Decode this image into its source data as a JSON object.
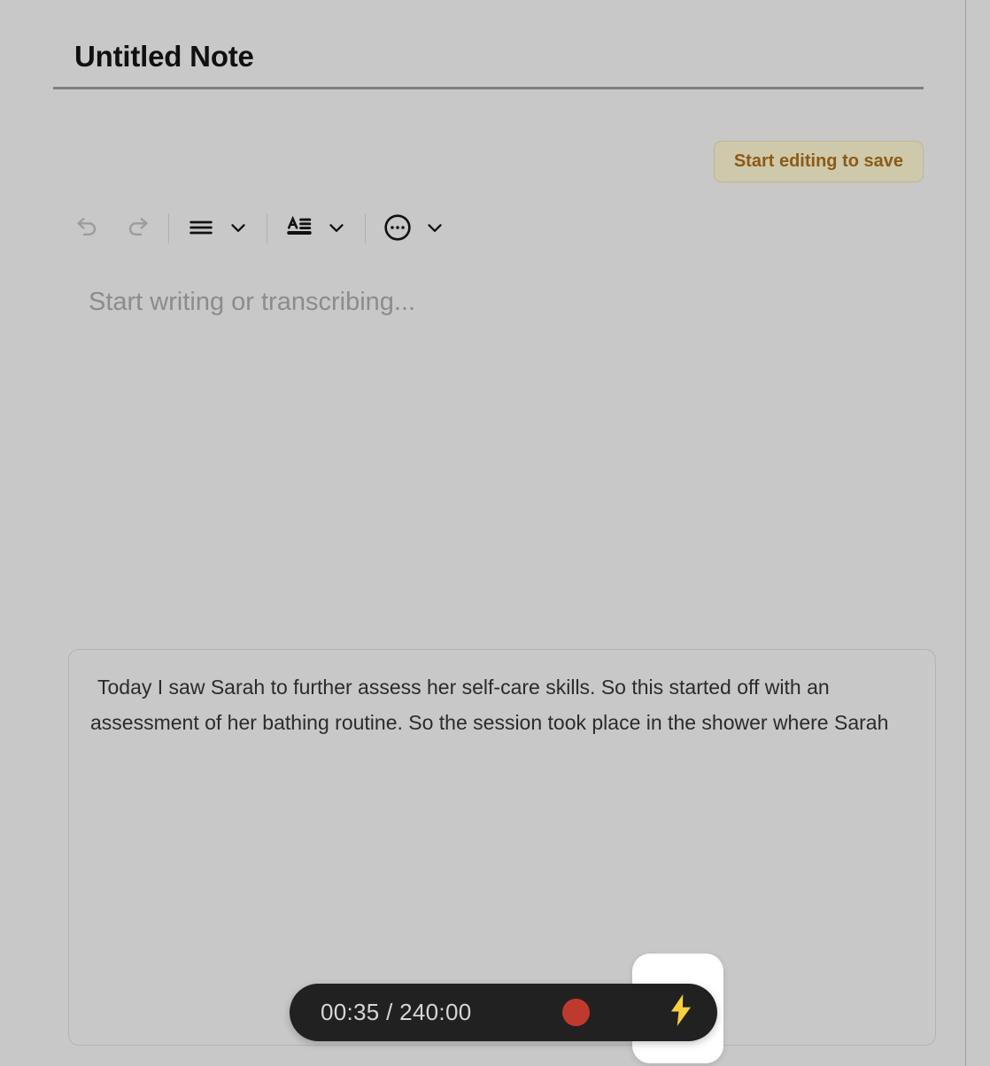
{
  "note": {
    "title": "Untitled Note",
    "save_status_label": "Start editing to save",
    "editor_placeholder": "Start writing or transcribing...",
    "editor_value": ""
  },
  "toolbar": {
    "items": [
      {
        "name": "undo-button",
        "icon": "undo-icon",
        "label": "Undo",
        "state": "disabled"
      },
      {
        "name": "redo-button",
        "icon": "redo-icon",
        "label": "Redo",
        "state": "disabled"
      },
      {
        "name": "align-button",
        "icon": "align-lines-icon",
        "label": "Alignment",
        "state": "enabled"
      },
      {
        "name": "align-dropdown",
        "icon": "chevron-down-icon",
        "label": "Alignment options",
        "state": "enabled"
      },
      {
        "name": "text-style-button",
        "icon": "text-format-a-icon",
        "label": "Text style",
        "state": "enabled"
      },
      {
        "name": "text-style-dropdown",
        "icon": "chevron-down-icon",
        "label": "Text style options",
        "state": "enabled"
      },
      {
        "name": "more-button",
        "icon": "circle-ellipsis-icon",
        "label": "More",
        "state": "enabled"
      },
      {
        "name": "more-dropdown",
        "icon": "chevron-down-icon",
        "label": "More options",
        "state": "enabled"
      }
    ]
  },
  "transcript": {
    "text": "Today I saw Sarah to further assess her self-care skills. So this started off with an assessment of her bathing routine. So the session took place in the shower where Sarah"
  },
  "recorder": {
    "elapsed": "00:35",
    "separator": "/",
    "total": "240:00",
    "timer_display": "00:35 / 240:00",
    "record_button_name": "stop-record-button",
    "boost_icon": "lightning-bolt-icon"
  },
  "colors": {
    "page_background": "#c8c8c8",
    "save_pill_background": "#cfc9ab",
    "save_pill_text": "#8c5a16",
    "recorder_pill_background": "#212121",
    "record_dot": "#c0392f",
    "bolt_yellow": "#f8cf3d",
    "boost_card": "#ffffff",
    "title_rule": "#808080"
  }
}
